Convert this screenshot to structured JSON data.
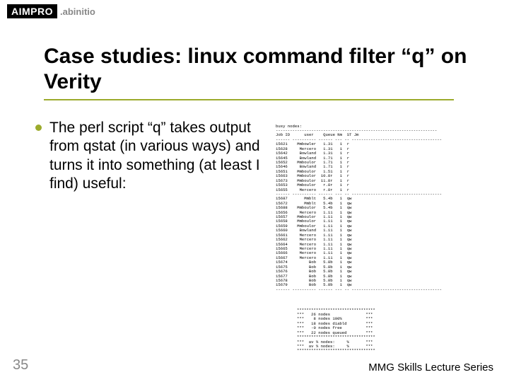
{
  "logo": {
    "brand": "AIMPRO",
    "sub": ".abinitio"
  },
  "title": "Case studies: linux command filter “q” on Verity",
  "bullet_text": "The perl script “q” takes output from qstat (in various ways) and turns it into something (at least I find) useful:",
  "page_number": "35",
  "footer": "MMG Skills Lecture Series",
  "term_header1": "busy nodes:\n--------------------------------------------------------------------\nJob ID      user    Queue Nm  ST Jm\n------ ---------- ------ --- -- --------------------------------------",
  "table": [
    {
      "id": "15621",
      "user": "Mmbowler",
      "q": "1.31",
      "n": "1",
      "s": "r"
    },
    {
      "id": "15628",
      "user": "Mercero",
      "q": "1.31",
      "n": "1",
      "s": "r"
    },
    {
      "id": "15642",
      "user": "Bowland",
      "q": "1.31",
      "n": "1",
      "s": "r"
    },
    {
      "id": "15645",
      "user": "Bowland",
      "q": "1.71",
      "n": "1",
      "s": "r"
    },
    {
      "id": "15652",
      "user": "Mmboulor",
      "q": "1.71",
      "n": "1",
      "s": "r"
    },
    {
      "id": "15646",
      "user": "Bowland",
      "q": "1.71",
      "n": "1",
      "s": "r"
    },
    {
      "id": "15651",
      "user": "Mmboulor",
      "q": "1.51",
      "n": "1",
      "s": "r"
    },
    {
      "id": "15663",
      "user": "Mmboulor",
      "q": "10.8r",
      "n": "1",
      "s": "r"
    },
    {
      "id": "15673",
      "user": "Mmboulor",
      "q": "11.8r",
      "n": "1",
      "s": "r"
    },
    {
      "id": "15653",
      "user": "Mmboulor",
      "q": "r.8r",
      "n": "1",
      "s": "r"
    },
    {
      "id": "15655",
      "user": "Mercero",
      "q": "r.8r",
      "n": "1",
      "s": "r"
    }
  ],
  "term_header2": "------ ---------- ------ --- -- --------------------------------------",
  "table2": [
    {
      "id": "15687",
      "user": "Mmblt",
      "q": "5.4b",
      "n": "1",
      "s": "qw"
    },
    {
      "id": "15672",
      "user": "Mmblt",
      "q": "5.4b",
      "n": "1",
      "s": "qw"
    },
    {
      "id": "15688",
      "user": "Mmboulor",
      "q": "5.4b",
      "n": "1",
      "s": "qw"
    },
    {
      "id": "15656",
      "user": "Mercero",
      "q": "1.11",
      "n": "1",
      "s": "qw"
    },
    {
      "id": "15657",
      "user": "Mmboulor",
      "q": "1.11",
      "n": "1",
      "s": "qw"
    },
    {
      "id": "15658",
      "user": "Mmboulor",
      "q": "1.11",
      "n": "1",
      "s": "qw"
    },
    {
      "id": "15659",
      "user": "Mmboulor",
      "q": "1.11",
      "n": "1",
      "s": "qw"
    },
    {
      "id": "15660",
      "user": "Bowland",
      "q": "1.11",
      "n": "1",
      "s": "qw"
    },
    {
      "id": "15661",
      "user": "Mercero",
      "q": "1.11",
      "n": "1",
      "s": "qw"
    },
    {
      "id": "15662",
      "user": "Mercero",
      "q": "1.11",
      "n": "1",
      "s": "qw"
    },
    {
      "id": "15664",
      "user": "Mercero",
      "q": "1.11",
      "n": "1",
      "s": "qw"
    },
    {
      "id": "15665",
      "user": "Mercero",
      "q": "1.11",
      "n": "1",
      "s": "qw"
    },
    {
      "id": "15666",
      "user": "Mercero",
      "q": "1.11",
      "n": "1",
      "s": "qw"
    },
    {
      "id": "15667",
      "user": "Mercero",
      "q": "1.11",
      "n": "1",
      "s": "qw"
    },
    {
      "id": "15674",
      "user": "Bob",
      "q": "5.8b",
      "n": "1",
      "s": "qw"
    },
    {
      "id": "15675",
      "user": "Bob",
      "q": "5.8b",
      "n": "1",
      "s": "qw"
    },
    {
      "id": "15676",
      "user": "Bob",
      "q": "5.8b",
      "n": "1",
      "s": "qw"
    },
    {
      "id": "15677",
      "user": "Bob",
      "q": "5.8b",
      "n": "1",
      "s": "qw"
    },
    {
      "id": "15678",
      "user": "Bob",
      "q": "5.8b",
      "n": "1",
      "s": "qw"
    },
    {
      "id": "15679",
      "user": "Bob",
      "q": "5.8b",
      "n": "1",
      "s": "qw"
    }
  ],
  "term_footer_rule": "------ ---------- ------ --- -- --------------------------------------",
  "summary": [
    "*********************************",
    "***   26 nodes               ***",
    "***    8 nodes 100%          ***",
    "***   18 nodes diabld        ***",
    "***   -0 nodes free          ***",
    "***   22 nodes queued        ***",
    "*********************************",
    "***  av % nodes:     %       ***",
    "***  av % nodes:     %       ***",
    "*********************************"
  ]
}
